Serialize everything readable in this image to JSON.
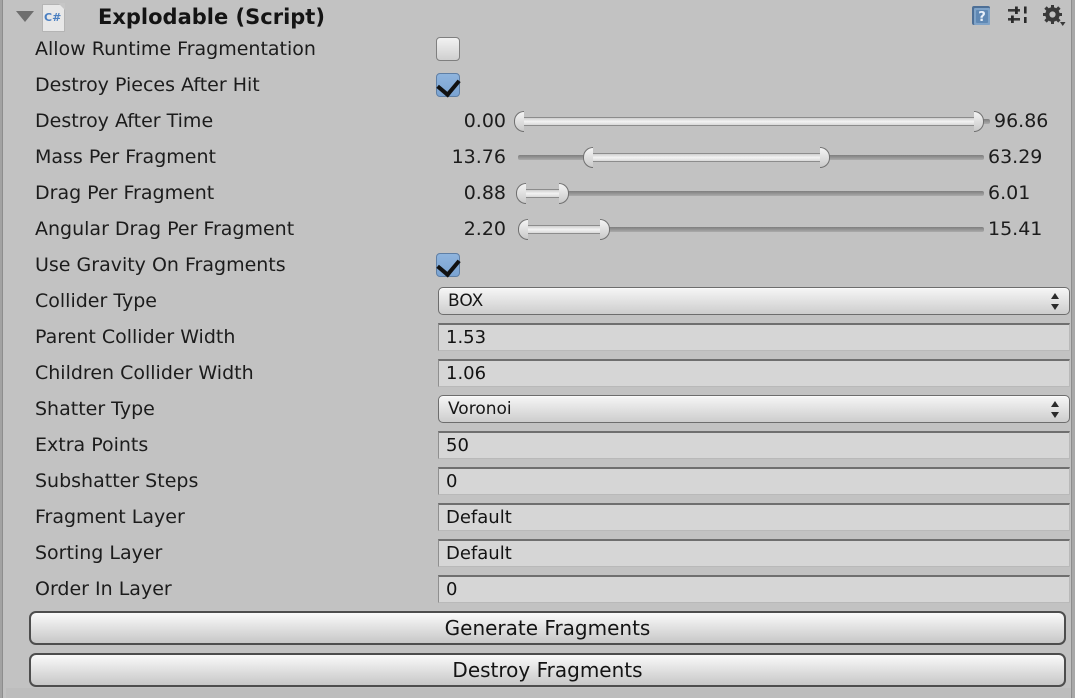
{
  "component": {
    "title": "Explodable (Script)",
    "script_icon_label": "C#",
    "foldout_state": "expanded"
  },
  "header_icons": [
    {
      "name": "help-icon",
      "glyph": "?"
    },
    {
      "name": "preset-icon",
      "glyph": "sliders"
    },
    {
      "name": "settings-gear-icon",
      "glyph": "gear"
    }
  ],
  "colors": {
    "background": "#c2c2c2",
    "checkbox_on": "#7aa3d2",
    "field_bg": "#d6d6d6",
    "script_icon_text": "#4a7fc1"
  },
  "rows": {
    "allow_runtime_fragmentation": {
      "label": "Allow Runtime Fragmentation",
      "type": "checkbox",
      "value": false
    },
    "destroy_pieces_after_hit": {
      "label": "Destroy Pieces After Hit",
      "type": "checkbox",
      "value": true
    },
    "destroy_after_time": {
      "label": "Destroy After Time",
      "type": "minmax-slider",
      "min_value": "0.00",
      "max_value": "96.86"
    },
    "mass_per_fragment": {
      "label": "Mass Per Fragment",
      "type": "minmax-slider",
      "min_value": "13.76",
      "max_value": "63.29"
    },
    "drag_per_fragment": {
      "label": "Drag Per Fragment",
      "type": "minmax-slider",
      "min_value": "0.88",
      "max_value": "6.01"
    },
    "angular_drag_per_fragment": {
      "label": "Angular Drag Per Fragment",
      "type": "minmax-slider",
      "min_value": "2.20",
      "max_value": "15.41"
    },
    "use_gravity_on_fragments": {
      "label": "Use Gravity On Fragments",
      "type": "checkbox",
      "value": true
    },
    "collider_type": {
      "label": "Collider Type",
      "type": "dropdown",
      "value": "BOX"
    },
    "parent_collider_width": {
      "label": "Parent Collider Width",
      "type": "text",
      "value": "1.53"
    },
    "children_collider_width": {
      "label": "Children Collider Width",
      "type": "text",
      "value": "1.06"
    },
    "shatter_type": {
      "label": "Shatter Type",
      "type": "dropdown",
      "value": "Voronoi"
    },
    "extra_points": {
      "label": "Extra Points",
      "type": "text",
      "value": "50"
    },
    "subshatter_steps": {
      "label": "Subshatter Steps",
      "type": "text",
      "value": "0"
    },
    "fragment_layer": {
      "label": "Fragment Layer",
      "type": "text",
      "value": "Default"
    },
    "sorting_layer": {
      "label": "Sorting Layer",
      "type": "text",
      "value": "Default"
    },
    "order_in_layer": {
      "label": "Order In Layer",
      "type": "text",
      "value": "0"
    }
  },
  "buttons": {
    "generate_fragments": "Generate Fragments",
    "destroy_fragments": "Destroy Fragments"
  }
}
